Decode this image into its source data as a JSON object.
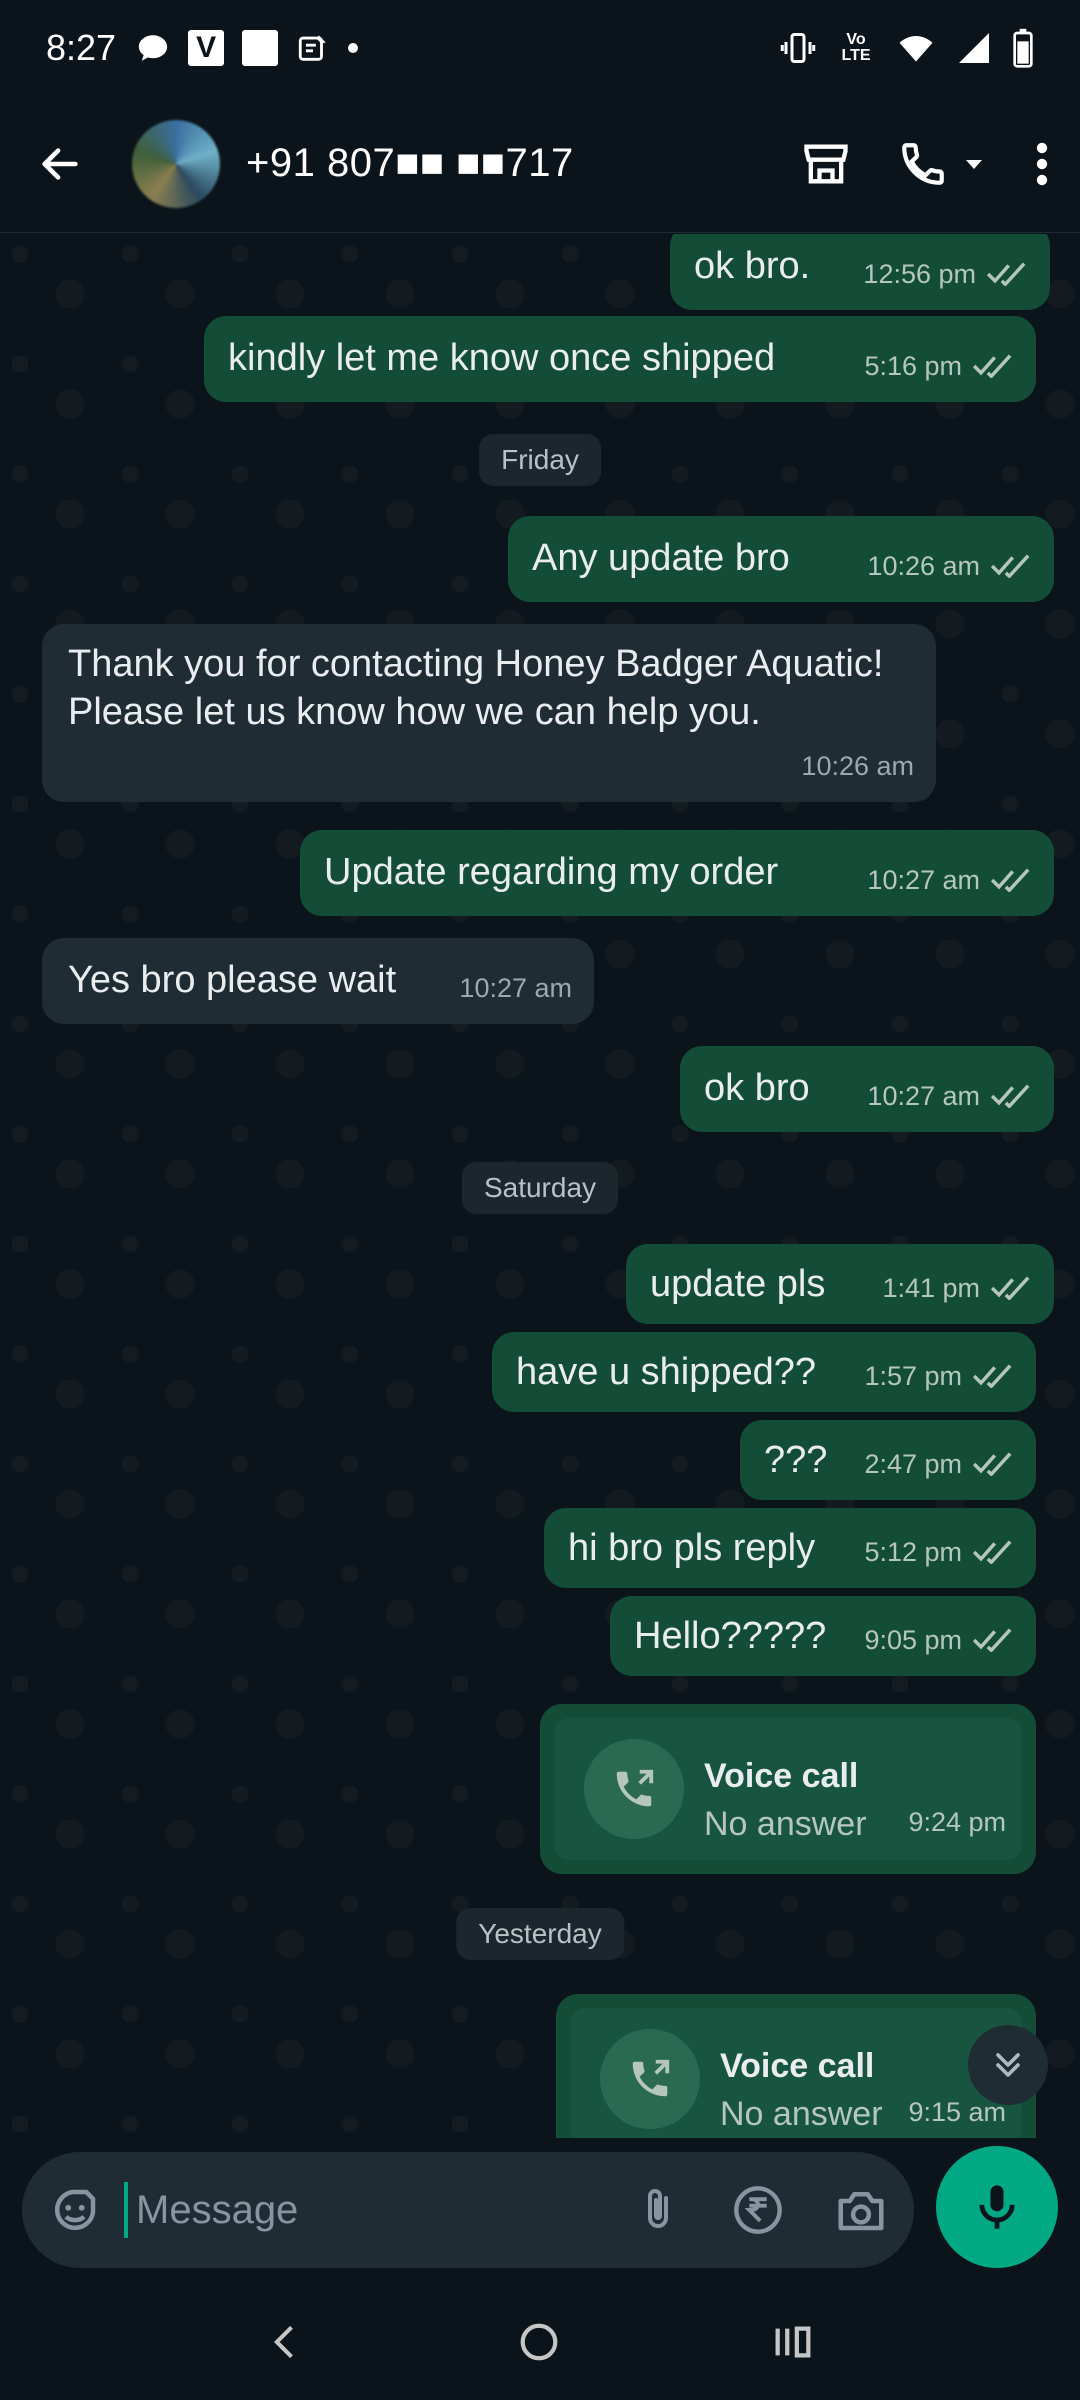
{
  "status_bar": {
    "time": "8:27",
    "volte": "Vo LTE"
  },
  "header": {
    "contact": "+91 807■■ ■■717"
  },
  "messages": [
    {
      "dir": "out",
      "text": "ok bro.",
      "time": "12:56 pm"
    },
    {
      "dir": "out",
      "text": "kindly let me know once shipped",
      "time": "5:16 pm"
    },
    {
      "date": "Friday"
    },
    {
      "dir": "out",
      "text": "Any update bro",
      "time": "10:26 am"
    },
    {
      "dir": "in",
      "text": "Thank you for contacting Honey Badger Aquatic! Please let us know how we can help you.",
      "time": "10:26 am"
    },
    {
      "dir": "out",
      "text": "Update regarding my order",
      "time": "10:27 am"
    },
    {
      "dir": "in",
      "text": "Yes bro please wait",
      "time": "10:27 am"
    },
    {
      "dir": "out",
      "text": "ok bro",
      "time": "10:27 am"
    },
    {
      "date": "Saturday"
    },
    {
      "dir": "out",
      "text": "update pls",
      "time": "1:41 pm"
    },
    {
      "dir": "out",
      "text": "have u shipped??",
      "time": "1:57 pm"
    },
    {
      "dir": "out",
      "text": "???",
      "time": "2:47 pm"
    },
    {
      "dir": "out",
      "text": "hi bro pls reply",
      "time": "5:12 pm"
    },
    {
      "dir": "out",
      "text": "Hello?????",
      "time": "9:05 pm"
    },
    {
      "call": true,
      "title": "Voice call",
      "sub": "No answer",
      "time": "9:24 pm"
    },
    {
      "date": "Yesterday"
    },
    {
      "call": true,
      "title": "Voice call",
      "sub": "No answer",
      "time": "9:15 am"
    }
  ],
  "composer": {
    "placeholder": "Message"
  }
}
